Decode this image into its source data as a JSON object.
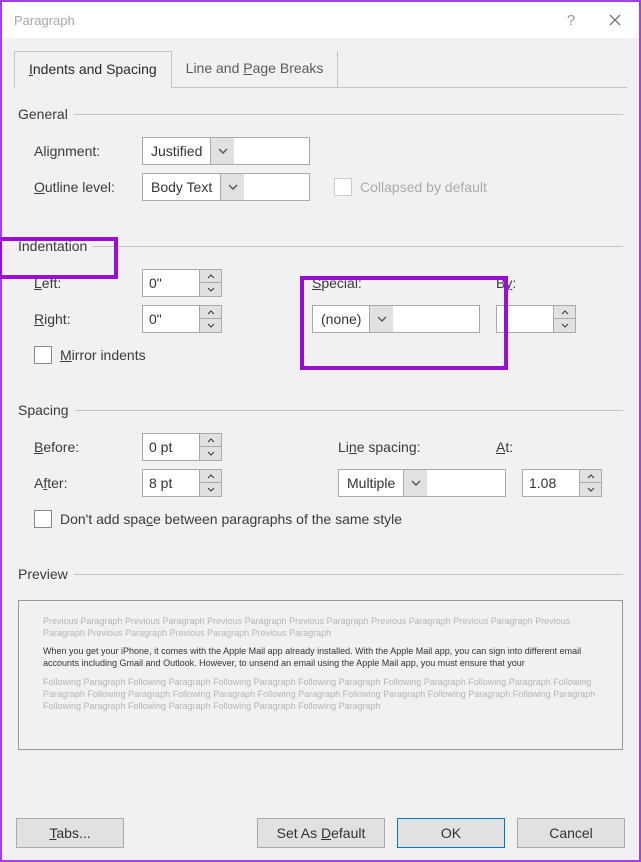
{
  "window": {
    "title": "Paragraph"
  },
  "tabs": {
    "t1": "Indents and Spacing",
    "t2": "Line and Page Breaks"
  },
  "general": {
    "legend": "General",
    "alignment_label": "Alignment:",
    "alignment_value": "Justified",
    "outline_label": "Outline level:",
    "outline_value": "Body Text",
    "collapsed_label": "Collapsed by default"
  },
  "indentation": {
    "legend": "Indentation",
    "left_label": "Left:",
    "left_value": "0\"",
    "right_label": "Right:",
    "right_value": "0\"",
    "special_label": "Special:",
    "special_value": "(none)",
    "by_label": "By:",
    "by_value": "",
    "mirror_label": "Mirror indents"
  },
  "spacing": {
    "legend": "Spacing",
    "before_label": "Before:",
    "before_value": "0 pt",
    "after_label": "After:",
    "after_value": "8 pt",
    "linespacing_label": "Line spacing:",
    "linespacing_value": "Multiple",
    "at_label": "At:",
    "at_value": "1.08",
    "dontadd_label": "Don't add space between paragraphs of the same style"
  },
  "preview": {
    "legend": "Preview",
    "prev_para": "Previous Paragraph Previous Paragraph Previous Paragraph Previous Paragraph Previous Paragraph Previous Paragraph Previous Paragraph Previous Paragraph Previous Paragraph Previous Paragraph",
    "body": "When you get your iPhone, it comes with the Apple Mail app already installed. With the Apple Mail app, you can sign into different email accounts including Gmail and Outlook. However, to unsend an email using the Apple Mail app, you must ensure that your",
    "foll_para": "Following Paragraph Following Paragraph Following Paragraph Following Paragraph Following Paragraph Following Paragraph Following Paragraph Following Paragraph Following Paragraph Following Paragraph Following Paragraph Following Paragraph Following Paragraph Following Paragraph Following Paragraph Following Paragraph Following Paragraph"
  },
  "buttons": {
    "tabs": "Tabs...",
    "setdefault": "Set As Default",
    "ok": "OK",
    "cancel": "Cancel"
  }
}
